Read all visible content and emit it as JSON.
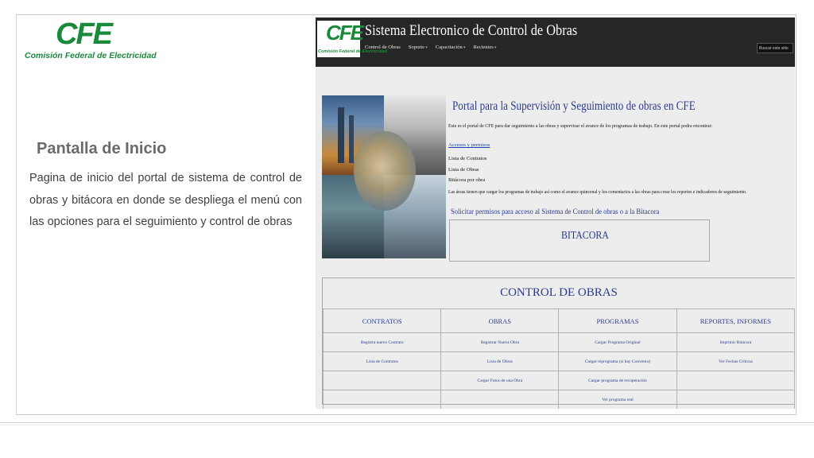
{
  "slide": {
    "logo": {
      "mark": "CFE",
      "caption": "Comisión Federal de Electricidad"
    },
    "title": "Pantalla de Inicio",
    "description": "Pagina de inicio del portal de sistema de control de obras  y bitácora en donde se despliega el menú con las opciones para el seguimiento y control de obras"
  },
  "screenshot": {
    "logo": {
      "mark": "CFE",
      "caption": "Comisión Federal de Electricidad"
    },
    "title": "Sistema Electronico de Control de Obras",
    "nav": [
      "Control de Obras",
      "Soporte",
      "Capacitación",
      "Recientes"
    ],
    "search": {
      "placeholder": "Buscar este sitio"
    },
    "portal": {
      "title": "Portal para la Supervisión y Seguimiento de obras en CFE",
      "intro": "Este es el portal de CFE para dar seguimiento a las obras y supervisar el avance de los programas de trabajo. En este portal podra encontrar:",
      "link": "Accesos y permisos",
      "items": [
        "Lista de Contratos",
        "Lista de Obras",
        "Bitácora por obra"
      ],
      "areas_note": "Las áreas tienen que cargar los programas de trabajo así como  el avance quincenal y los comentarios a las obras para crear los reportes e indicadores de seguimiento.",
      "request": "Solicitar permisos para acceso al Sistema de Control de obras o a  la Bitacora",
      "bitacora": "BITACORA"
    },
    "control": {
      "title": "CONTROL DE OBRAS",
      "headers": [
        "CONTRATOS",
        "OBRAS",
        "PROGRAMAS",
        "REPORTES, INFORMES"
      ],
      "rows": [
        [
          "Registra nuevo Contrato",
          "Registrar Nueva Obra",
          "Cargar Programa Original",
          "Imprimir Bitácora"
        ],
        [
          "Lista de Contratos",
          "Lista de Obras",
          "Cargar reprograma (si hay Convenio)",
          "Ver Fechas Críticas"
        ],
        [
          "",
          "Cargar Fotos de una Obra",
          "Cargar programa de recuperación",
          ""
        ],
        [
          "",
          "",
          "Ver programa real",
          ""
        ]
      ]
    }
  }
}
